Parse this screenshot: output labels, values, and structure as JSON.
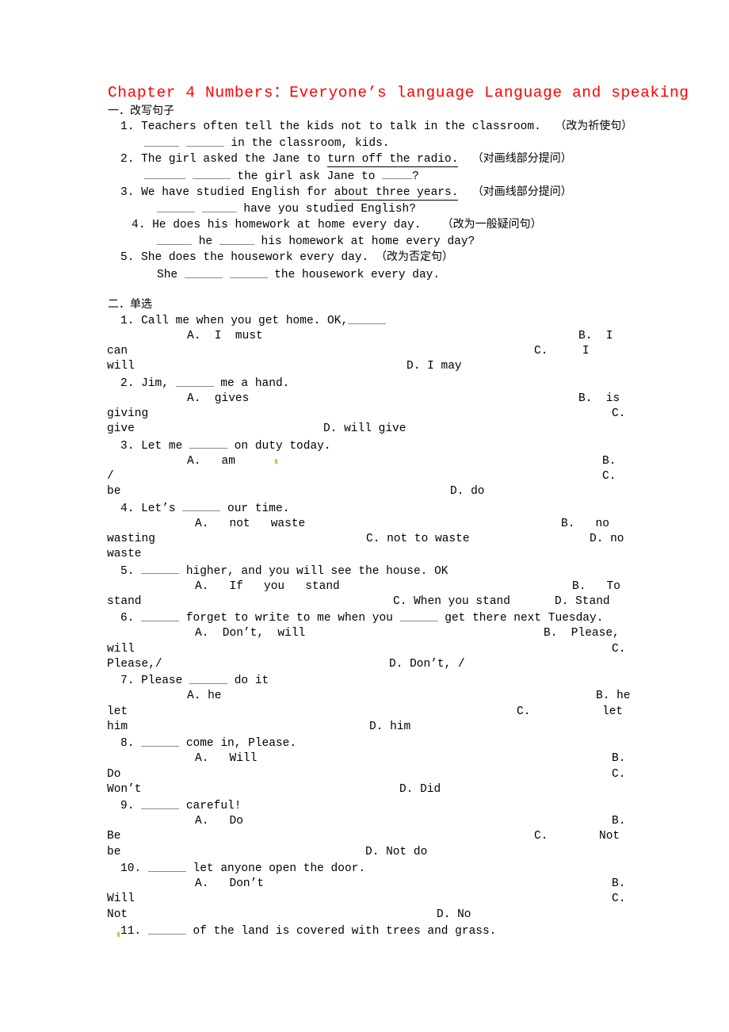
{
  "document": {
    "title": "Chapter 4 Numbers：Everyone’s language Language and speaking",
    "title_color": "#ff0000"
  },
  "section_one": {
    "heading": "一．改写句子",
    "questions": [
      {
        "number": "1.",
        "prompt": "Teachers often tell the kids not to talk in the classroom.",
        "instruction": "（改为祈使句）",
        "answer_line_tail": "in the classroom, kids."
      },
      {
        "number": "2.",
        "prompt_before": "The girl asked the Jane to",
        "underlined": "turn off the radio.",
        "instruction": "（对画线部分提问）",
        "answer_mid": "the girl ask Jane to",
        "answer_tail": "?"
      },
      {
        "number": "3.",
        "prompt_before": "We have studied English for",
        "underlined": "about three years.",
        "instruction": "（对画线部分提问）",
        "answer_line_tail": "have you studied English?"
      },
      {
        "number": "4.",
        "prompt": "He does his homework at home every day.",
        "instruction": "（改为一般疑问句）",
        "answer_mid": "he",
        "answer_tail": "his homework at home every day?"
      },
      {
        "number": "5.",
        "prompt": "She does the housework every day.",
        "instruction": "（改为否定句）",
        "answer_lead": "She",
        "answer_tail": "the housework every day."
      }
    ]
  },
  "section_two": {
    "heading": "二．单选",
    "questions": [
      {
        "number": "1.",
        "stem_before": "Call me when you get home. OK,",
        "stem_after": "",
        "options": {
          "a": "A.  I  must",
          "b": "B.  I",
          "b_wrap": "can",
          "c": "C.     I",
          "c_wrap": "will",
          "d": "D. I may"
        }
      },
      {
        "number": "2.",
        "stem_before": "Jim,",
        "stem_after": "me a hand.",
        "options": {
          "a": "A.  gives",
          "b": "B.  is",
          "b_wrap": "giving",
          "c": "C.",
          "c_wrap": "give",
          "d": "D. will give"
        }
      },
      {
        "number": "3.",
        "stem_before": "Let me",
        "stem_after": "on duty today.",
        "options": {
          "a": "A.   am",
          "b": "B.",
          "b_wrap": "/",
          "c": "C.",
          "c_wrap": "be",
          "d": "D. do"
        }
      },
      {
        "number": "4.",
        "stem_before": "Let’s",
        "stem_after": "our time.",
        "options": {
          "a": "A.   not   waste",
          "b": "B.   no",
          "b_wrap": "wasting",
          "c": "C. not to waste",
          "d": "D. no",
          "d_wrap": "waste"
        }
      },
      {
        "number": "5.",
        "stem_before": "",
        "stem_after": "higher, and you will see the house. OK",
        "options": {
          "a": "A.   If   you   stand",
          "b": "B.   To",
          "b_wrap": "stand",
          "c": "C. When you stand",
          "d": "D. Stand"
        }
      },
      {
        "number": "6.",
        "stem_before": "",
        "stem_mid": "forget to write to me when you",
        "stem_after": "get there next Tuesday.",
        "options": {
          "a": "A.  Don’t,  will",
          "b": "B.  Please,",
          "b_wrap": "will",
          "c": "C.",
          "c_wrap": "Please,/",
          "d": "D. Don’t, /"
        }
      },
      {
        "number": "7.",
        "stem_before": "Please",
        "stem_after": "do it",
        "options": {
          "a": "A. he",
          "b": "B. he",
          "b_wrap": "let",
          "c": "C.",
          "c_wrap": "him",
          "c_tail": "let",
          "d": "D. him"
        }
      },
      {
        "number": "8.",
        "stem_before": "",
        "stem_after": "come in, Please.",
        "options": {
          "a": "A.   Will",
          "b": "B.",
          "b_wrap": "Do",
          "c": "C.",
          "c_wrap": "Won’t",
          "d": "D. Did"
        }
      },
      {
        "number": "9.",
        "stem_before": "",
        "stem_after": "careful!",
        "options": {
          "a": "A.   Do",
          "b": "B.",
          "b_wrap": "Be",
          "c": "C.",
          "c_tail": "Not",
          "c_wrap": "be",
          "d": "D. Not do"
        }
      },
      {
        "number": "10.",
        "stem_before": "",
        "stem_after": "let anyone open the door.",
        "options": {
          "a": "A.   Don’t",
          "b": "B.",
          "b_wrap": "Will",
          "c": "C.",
          "c_wrap": "Not",
          "d": "D. No"
        }
      },
      {
        "number": "11.",
        "stem_before": "",
        "stem_after": "of the land is covered with trees and grass."
      }
    ]
  }
}
